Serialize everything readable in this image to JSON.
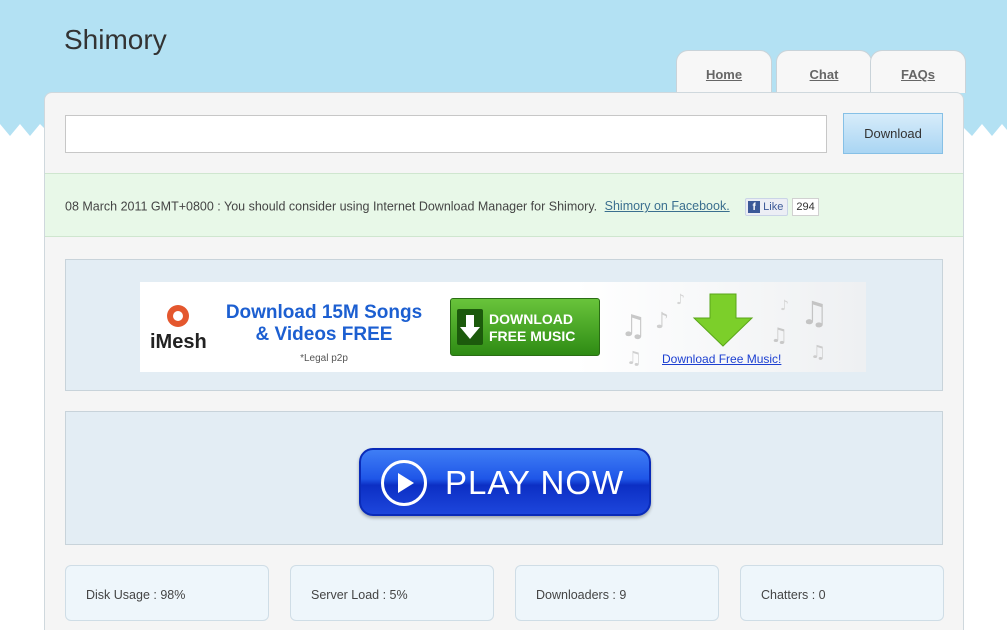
{
  "site": {
    "title": "Shimory"
  },
  "nav": {
    "tabs": [
      {
        "label": "Home"
      },
      {
        "label": "Chat"
      },
      {
        "label": "FAQs"
      }
    ]
  },
  "search": {
    "value": "",
    "placeholder": "",
    "button_label": "Download"
  },
  "notice": {
    "text": "08 March 2011 GMT+0800 : You should consider using Internet Download Manager for Shimory.",
    "link_text": "Shimory on Facebook.",
    "like_label": "Like",
    "like_count": "294"
  },
  "ad": {
    "brand": "iMesh",
    "headline_line1": "Download 15M Songs",
    "headline_line2": "& Videos FREE",
    "legal": "*Legal p2p",
    "button_line1": "DOWNLOAD",
    "button_line2": "FREE MUSIC",
    "link": "Download Free Music!"
  },
  "play": {
    "label": "PLAY NOW"
  },
  "stats": [
    {
      "label": "Disk Usage : 98%"
    },
    {
      "label": "Server Load : 5%"
    },
    {
      "label": "Downloaders : 9"
    },
    {
      "label": "Chatters : 0"
    }
  ],
  "colors": {
    "sky": "#b3e1f3",
    "notice_bg": "#e8f8e8",
    "panel_bg": "#e3edf4",
    "play_blue": "#1f56e8"
  }
}
